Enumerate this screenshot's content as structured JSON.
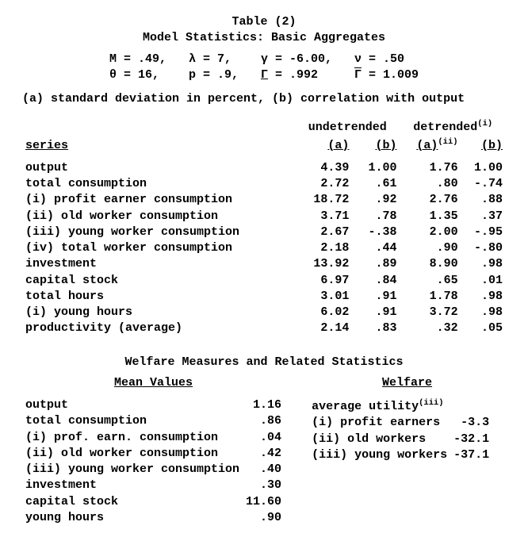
{
  "title_line1": "Table (2)",
  "title_line2": "Model Statistics: Basic Aggregates",
  "params": {
    "c1a": "M = .49,",
    "c1b": "θ = 16,",
    "c2a": "λ = 7,",
    "c2b": "p = .9,",
    "c3a": "γ = -6.00,",
    "c3b_pre": "Γ",
    "c3b_post": " = .992",
    "c4a": "ν = .50",
    "c4b_pre": "Γ",
    "c4b_post": " = 1.009"
  },
  "note": "(a) standard deviation in percent, (b) correlation with output",
  "head": {
    "undet": "undetrended",
    "det": "detrended",
    "det_sup": "(i)",
    "series": "series",
    "a": "(a)",
    "b": "(b)",
    "a2": "(a)",
    "a2_sup": "(ii)",
    "b2": "(b)"
  },
  "rows": [
    {
      "label": "output",
      "ind": "",
      "a": "4.39",
      "b": "1.00",
      "da": "1.76",
      "db": "1.00"
    },
    {
      "label": "total consumption",
      "ind": "",
      "a": "2.72",
      "b": ".61",
      "da": ".80",
      "db": "-.74"
    },
    {
      "label": "(i) profit earner consumption",
      "ind": "ind1",
      "a": "18.72",
      "b": ".92",
      "da": "2.76",
      "db": ".88"
    },
    {
      "label": "(ii) old worker consumption",
      "ind": "ind1",
      "a": "3.71",
      "b": ".78",
      "da": "1.35",
      "db": ".37"
    },
    {
      "label": "(iii) young worker consumption",
      "ind": "",
      "a": "2.67",
      "b": "-.38",
      "da": "2.00",
      "db": "-.95"
    },
    {
      "label": "(iv) total worker consumption",
      "ind": "ind1",
      "a": "2.18",
      "b": ".44",
      "da": ".90",
      "db": "-.80"
    },
    {
      "label": "investment",
      "ind": "",
      "a": "13.92",
      "b": ".89",
      "da": "8.90",
      "db": ".98"
    },
    {
      "label": "capital stock",
      "ind": "",
      "a": "6.97",
      "b": ".84",
      "da": ".65",
      "db": ".01"
    },
    {
      "label": "total hours",
      "ind": "",
      "a": "3.01",
      "b": ".91",
      "da": "1.78",
      "db": ".98"
    },
    {
      "label": "(i) young hours",
      "ind": "",
      "a": "6.02",
      "b": ".91",
      "da": "3.72",
      "db": ".98"
    },
    {
      "label": "productivity (average)",
      "ind": "",
      "a": "2.14",
      "b": ".83",
      "da": ".32",
      "db": ".05"
    }
  ],
  "welfare_title": "Welfare Measures and Related Statistics",
  "mv_head": "Mean Values",
  "w_head": "Welfare",
  "mv_rows": [
    {
      "label": "output",
      "ind": "",
      "v": "1.16"
    },
    {
      "label": "total consumption",
      "ind": "",
      "v": ".86"
    },
    {
      "label": "(i) prof. earn. consumption",
      "ind": "ind1",
      "v": ".04"
    },
    {
      "label": "(ii) old worker consumption",
      "ind": "ind1",
      "v": ".42"
    },
    {
      "label": "(iii) young worker consumption",
      "ind": "",
      "v": ".40"
    },
    {
      "label": "investment",
      "ind": "",
      "v": ".30"
    },
    {
      "label": "capital stock",
      "ind": "",
      "v": "11.60"
    },
    {
      "label": "young hours",
      "ind": "",
      "v": ".90"
    }
  ],
  "w": {
    "avg": "average utility",
    "avg_sup": "(iii)",
    "r1": "(i) profit earners",
    "v1": "-3.3",
    "r2": "(ii) old workers",
    "v2": "-32.1",
    "r3": "(iii) young workers",
    "v3": "-37.1"
  }
}
